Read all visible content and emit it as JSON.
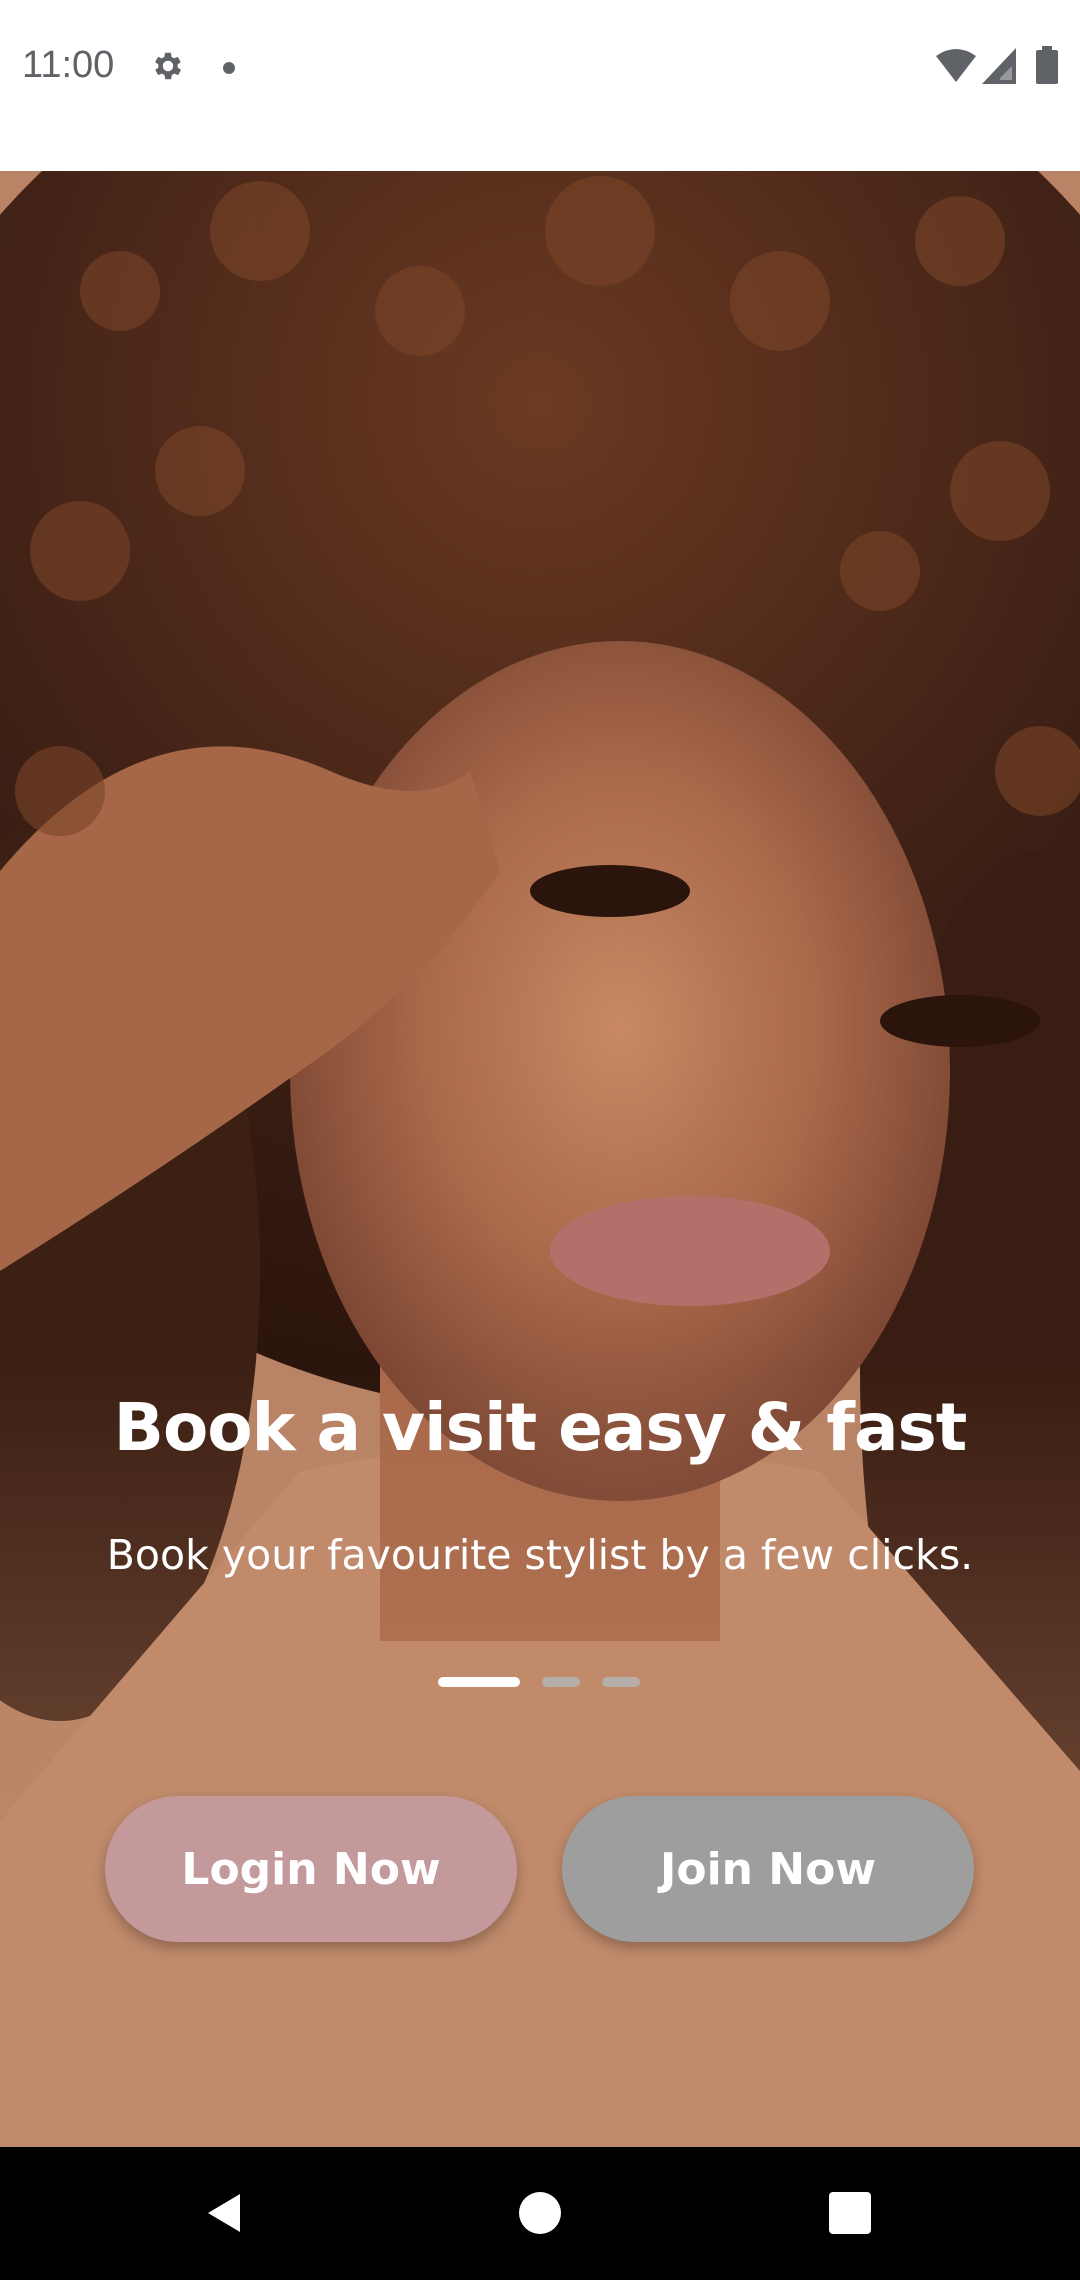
{
  "status_bar": {
    "time": "11:00",
    "icons": [
      "gear-icon",
      "notification-dot-icon",
      "wifi-icon",
      "signal-icon",
      "battery-icon"
    ]
  },
  "onboarding": {
    "title": "Book a visit easy & fast",
    "subtitle": "Book your favourite stylist by a few clicks.",
    "page_indicator": {
      "total": 3,
      "active_index": 0
    },
    "login_label": "Login Now",
    "join_label": "Join Now"
  },
  "colors": {
    "login_button": "#c4999b",
    "join_button": "#9e9e9e",
    "status_bar_bg": "#ffffff",
    "nav_bar_bg": "#000000"
  },
  "nav_bar": {
    "icons": [
      "back-icon",
      "home-icon",
      "recents-icon"
    ]
  }
}
